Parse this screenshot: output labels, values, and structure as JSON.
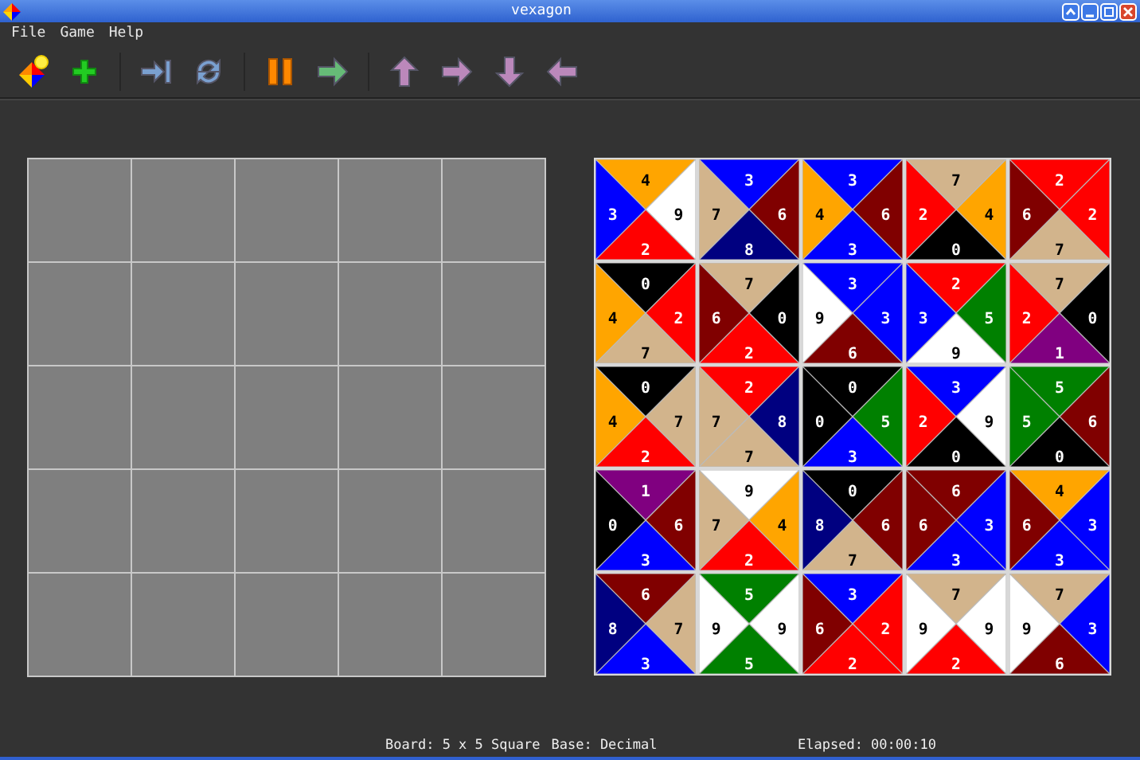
{
  "window": {
    "title": "vexagon"
  },
  "menu": [
    "File",
    "Game",
    "Help"
  ],
  "tiles": [
    {
      "sides": [
        {
          "n": "4",
          "color": "#ffa500"
        },
        {
          "n": "9",
          "color": "#ffffff"
        },
        {
          "n": "2",
          "color": "#ff0000"
        },
        {
          "n": "3",
          "color": "#0000ff"
        }
      ]
    },
    {
      "sides": [
        {
          "n": "3",
          "color": "#0000ff"
        },
        {
          "n": "6",
          "color": "#800000"
        },
        {
          "n": "8",
          "color": "#000080"
        },
        {
          "n": "7",
          "color": "#d2b48c"
        }
      ]
    },
    {
      "sides": [
        {
          "n": "3",
          "color": "#0000ff"
        },
        {
          "n": "6",
          "color": "#800000"
        },
        {
          "n": "3",
          "color": "#0000ff"
        },
        {
          "n": "4",
          "color": "#ffa500"
        }
      ]
    },
    {
      "sides": [
        {
          "n": "7",
          "color": "#d2b48c"
        },
        {
          "n": "4",
          "color": "#ffa500"
        },
        {
          "n": "0",
          "color": "#000000"
        },
        {
          "n": "2",
          "color": "#ff0000"
        }
      ]
    },
    {
      "sides": [
        {
          "n": "2",
          "color": "#ff0000"
        },
        {
          "n": "2",
          "color": "#ff0000"
        },
        {
          "n": "7",
          "color": "#d2b48c"
        },
        {
          "n": "6",
          "color": "#800000"
        }
      ]
    },
    {
      "sides": [
        {
          "n": "0",
          "color": "#000000"
        },
        {
          "n": "2",
          "color": "#ff0000"
        },
        {
          "n": "7",
          "color": "#d2b48c"
        },
        {
          "n": "4",
          "color": "#ffa500"
        }
      ]
    },
    {
      "sides": [
        {
          "n": "7",
          "color": "#d2b48c"
        },
        {
          "n": "0",
          "color": "#000000"
        },
        {
          "n": "2",
          "color": "#ff0000"
        },
        {
          "n": "6",
          "color": "#800000"
        }
      ]
    },
    {
      "sides": [
        {
          "n": "3",
          "color": "#0000ff"
        },
        {
          "n": "3",
          "color": "#0000ff"
        },
        {
          "n": "6",
          "color": "#800000"
        },
        {
          "n": "9",
          "color": "#ffffff"
        }
      ]
    },
    {
      "sides": [
        {
          "n": "2",
          "color": "#ff0000"
        },
        {
          "n": "5",
          "color": "#008000"
        },
        {
          "n": "9",
          "color": "#ffffff"
        },
        {
          "n": "3",
          "color": "#0000ff"
        }
      ]
    },
    {
      "sides": [
        {
          "n": "7",
          "color": "#d2b48c"
        },
        {
          "n": "0",
          "color": "#000000"
        },
        {
          "n": "1",
          "color": "#800080"
        },
        {
          "n": "2",
          "color": "#ff0000"
        }
      ]
    },
    {
      "sides": [
        {
          "n": "0",
          "color": "#000000"
        },
        {
          "n": "7",
          "color": "#d2b48c"
        },
        {
          "n": "2",
          "color": "#ff0000"
        },
        {
          "n": "4",
          "color": "#ffa500"
        }
      ]
    },
    {
      "sides": [
        {
          "n": "2",
          "color": "#ff0000"
        },
        {
          "n": "8",
          "color": "#000080"
        },
        {
          "n": "7",
          "color": "#d2b48c"
        },
        {
          "n": "7",
          "color": "#d2b48c"
        }
      ]
    },
    {
      "sides": [
        {
          "n": "0",
          "color": "#000000"
        },
        {
          "n": "5",
          "color": "#008000"
        },
        {
          "n": "3",
          "color": "#0000ff"
        },
        {
          "n": "0",
          "color": "#000000"
        }
      ]
    },
    {
      "sides": [
        {
          "n": "3",
          "color": "#0000ff"
        },
        {
          "n": "9",
          "color": "#ffffff"
        },
        {
          "n": "0",
          "color": "#000000"
        },
        {
          "n": "2",
          "color": "#ff0000"
        }
      ]
    },
    {
      "sides": [
        {
          "n": "5",
          "color": "#008000"
        },
        {
          "n": "6",
          "color": "#800000"
        },
        {
          "n": "0",
          "color": "#000000"
        },
        {
          "n": "5",
          "color": "#008000"
        }
      ]
    },
    {
      "sides": [
        {
          "n": "1",
          "color": "#800080"
        },
        {
          "n": "6",
          "color": "#800000"
        },
        {
          "n": "3",
          "color": "#0000ff"
        },
        {
          "n": "0",
          "color": "#000000"
        }
      ]
    },
    {
      "sides": [
        {
          "n": "9",
          "color": "#ffffff"
        },
        {
          "n": "4",
          "color": "#ffa500"
        },
        {
          "n": "2",
          "color": "#ff0000"
        },
        {
          "n": "7",
          "color": "#d2b48c"
        }
      ]
    },
    {
      "sides": [
        {
          "n": "0",
          "color": "#000000"
        },
        {
          "n": "6",
          "color": "#800000"
        },
        {
          "n": "7",
          "color": "#d2b48c"
        },
        {
          "n": "8",
          "color": "#000080"
        }
      ]
    },
    {
      "sides": [
        {
          "n": "6",
          "color": "#800000"
        },
        {
          "n": "3",
          "color": "#0000ff"
        },
        {
          "n": "3",
          "color": "#0000ff"
        },
        {
          "n": "6",
          "color": "#800000"
        }
      ]
    },
    {
      "sides": [
        {
          "n": "4",
          "color": "#ffa500"
        },
        {
          "n": "3",
          "color": "#0000ff"
        },
        {
          "n": "3",
          "color": "#0000ff"
        },
        {
          "n": "6",
          "color": "#800000"
        }
      ]
    },
    {
      "sides": [
        {
          "n": "6",
          "color": "#800000"
        },
        {
          "n": "7",
          "color": "#d2b48c"
        },
        {
          "n": "3",
          "color": "#0000ff"
        },
        {
          "n": "8",
          "color": "#000080"
        }
      ]
    },
    {
      "sides": [
        {
          "n": "5",
          "color": "#008000"
        },
        {
          "n": "9",
          "color": "#ffffff"
        },
        {
          "n": "5",
          "color": "#008000"
        },
        {
          "n": "9",
          "color": "#ffffff"
        }
      ]
    },
    {
      "sides": [
        {
          "n": "3",
          "color": "#0000ff"
        },
        {
          "n": "2",
          "color": "#ff0000"
        },
        {
          "n": "2",
          "color": "#ff0000"
        },
        {
          "n": "6",
          "color": "#800000"
        }
      ]
    },
    {
      "sides": [
        {
          "n": "7",
          "color": "#d2b48c"
        },
        {
          "n": "9",
          "color": "#ffffff"
        },
        {
          "n": "2",
          "color": "#ff0000"
        },
        {
          "n": "9",
          "color": "#ffffff"
        }
      ]
    },
    {
      "sides": [
        {
          "n": "7",
          "color": "#d2b48c"
        },
        {
          "n": "3",
          "color": "#0000ff"
        },
        {
          "n": "6",
          "color": "#800000"
        },
        {
          "n": "9",
          "color": "#ffffff"
        }
      ]
    }
  ],
  "status_bar": {
    "board": "Board: 5 x 5 Square",
    "base": "Base: Decimal",
    "elapsed": "Elapsed: 00:00:10"
  }
}
